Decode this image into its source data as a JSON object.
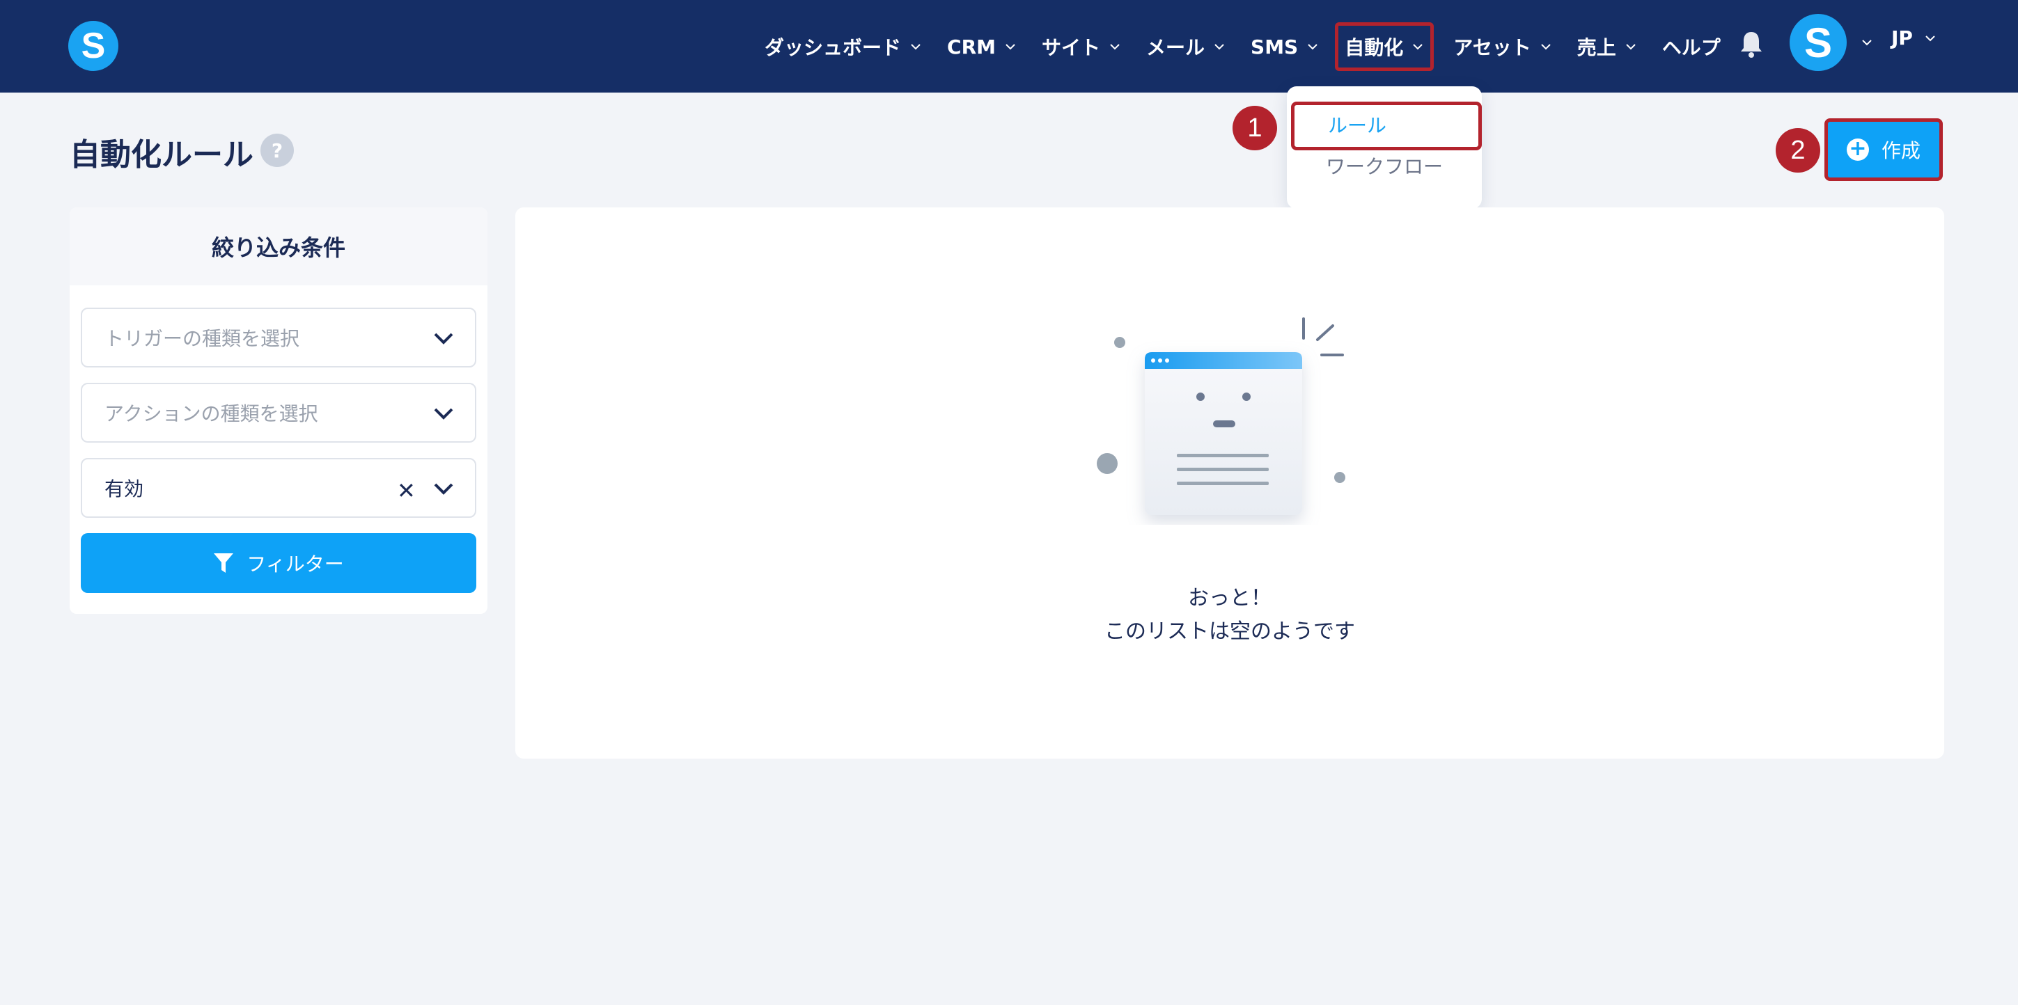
{
  "brand": {
    "logo_letter": "S"
  },
  "nav": {
    "items": [
      {
        "label": "ダッシュボード"
      },
      {
        "label": "CRM"
      },
      {
        "label": "サイト"
      },
      {
        "label": "メール"
      },
      {
        "label": "SMS"
      },
      {
        "label": "自動化"
      },
      {
        "label": "アセット"
      },
      {
        "label": "売上"
      },
      {
        "label": "ヘルプ"
      }
    ],
    "avatar_letter": "S",
    "language": "JP"
  },
  "dropdown": {
    "items": [
      {
        "label": "ルール"
      },
      {
        "label": "ワークフロー"
      }
    ]
  },
  "steps": {
    "one": "1",
    "two": "2"
  },
  "page": {
    "title": "自動化ルール",
    "help": "?",
    "create_label": "作成"
  },
  "filter": {
    "heading": "絞り込み条件",
    "trigger_placeholder": "トリガーの種類を選択",
    "action_placeholder": "アクションの種類を選択",
    "status_value": "有効",
    "clear_symbol": "✕",
    "button_label": "フィルター"
  },
  "empty": {
    "line1": "おっと！",
    "line2": "このリストは空のようです"
  },
  "colors": {
    "navbar": "#152e66",
    "accent": "#0ea2f7",
    "highlight": "#b3232d",
    "background": "#f2f4f8"
  }
}
